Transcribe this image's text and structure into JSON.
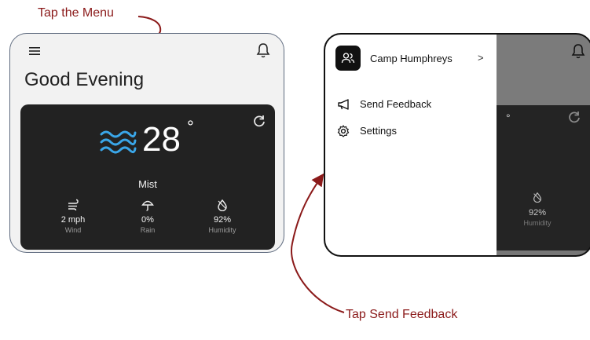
{
  "annotations": {
    "step1": "Tap the Menu",
    "step2": "Tap Send Feedback"
  },
  "colors": {
    "annotation": "#8b1a1a",
    "card_dark": "#222222",
    "accent_blue": "#3aa6e8"
  },
  "home": {
    "greeting": "Good Evening",
    "weather": {
      "temperature": "28",
      "degree_symbol": "°",
      "condition": "Mist",
      "icon": "waves-icon",
      "stats": [
        {
          "icon": "wind-icon",
          "value": "2 mph",
          "label": "Wind"
        },
        {
          "icon": "umbrella-icon",
          "value": "0%",
          "label": "Rain"
        },
        {
          "icon": "droplet-icon",
          "value": "92%",
          "label": "Humidity"
        }
      ]
    }
  },
  "drawer": {
    "account_name": "Camp Humphreys",
    "chevron": ">",
    "items": [
      {
        "icon": "megaphone-icon",
        "label": "Send Feedback"
      },
      {
        "icon": "gear-icon",
        "label": "Settings"
      }
    ]
  },
  "peek": {
    "degree_symbol": "°",
    "humidity_value": "92%",
    "humidity_label": "Humidity"
  }
}
